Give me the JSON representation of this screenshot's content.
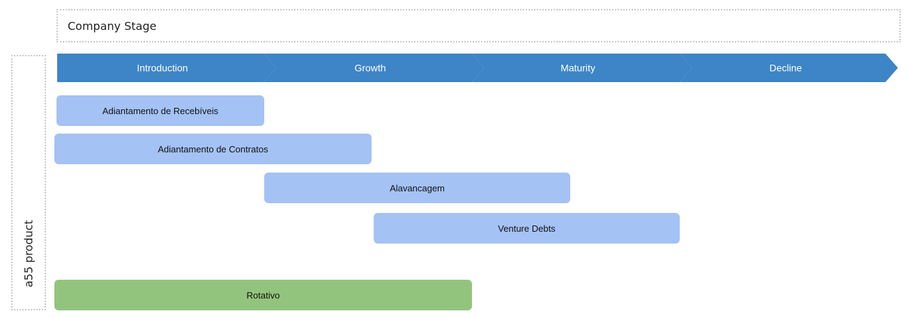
{
  "header": {
    "title": "Company Stage"
  },
  "side": {
    "title": "a55 product"
  },
  "phases": [
    {
      "label": "Introduction"
    },
    {
      "label": "Growth"
    },
    {
      "label": "Maturity"
    },
    {
      "label": "Decline"
    }
  ],
  "products": [
    {
      "label": "Adiantamento de Recebíveis"
    },
    {
      "label": "Adiantamento de Contratos"
    },
    {
      "label": "Alavancagem"
    },
    {
      "label": "Venture Debts"
    },
    {
      "label": "Rotativo"
    }
  ],
  "colors": {
    "phase_fill": "#3d85c6",
    "product_blue": "#a4c2f4",
    "product_green": "#93c47d"
  }
}
